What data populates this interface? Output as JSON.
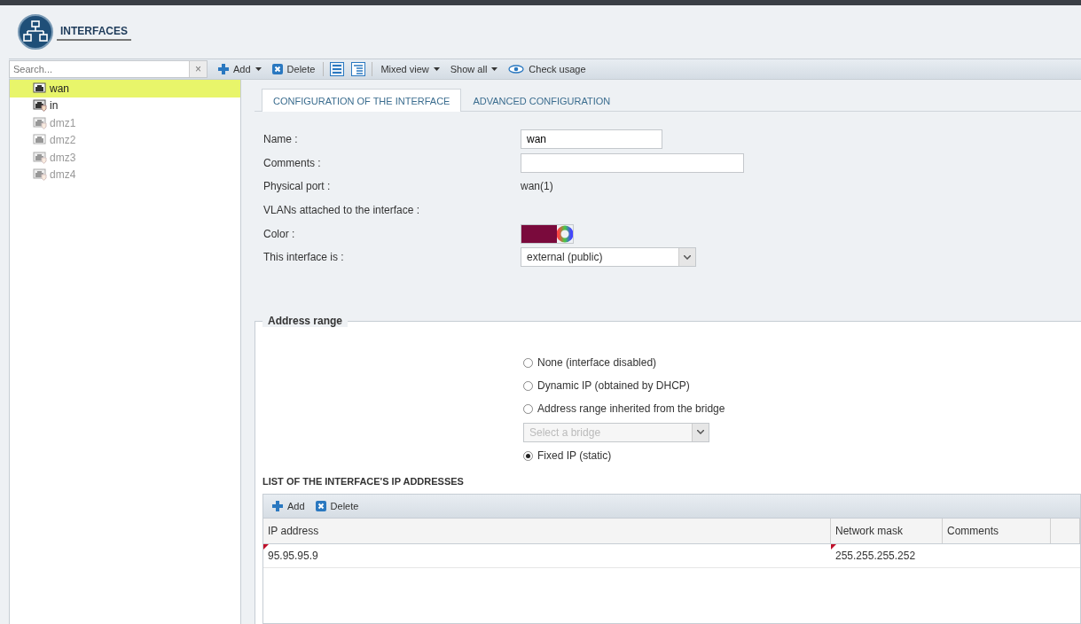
{
  "header": {
    "title": "INTERFACES"
  },
  "toolbar": {
    "search": {
      "placeholder": "Search..."
    },
    "clear": "×",
    "items": [
      {
        "kind": "add",
        "label": "Add",
        "dropdown": true
      },
      {
        "kind": "delete",
        "label": "Delete",
        "dropdown": false
      },
      {
        "kind": "separator"
      },
      {
        "kind": "expand"
      },
      {
        "kind": "collapse"
      },
      {
        "kind": "separator"
      },
      {
        "kind": "text",
        "label": "Mixed view",
        "dropdown": true
      },
      {
        "kind": "text",
        "label": "Show all",
        "dropdown": true
      },
      {
        "kind": "eye",
        "label": "Check usage",
        "dropdown": false
      }
    ]
  },
  "sidebar": {
    "items": [
      {
        "label": "wan",
        "selected": true,
        "disabled": false,
        "kind": "external"
      },
      {
        "label": "in",
        "selected": false,
        "disabled": false,
        "kind": "protected"
      },
      {
        "label": "dmz1",
        "selected": false,
        "disabled": true,
        "kind": "protected"
      },
      {
        "label": "dmz2",
        "selected": false,
        "disabled": true,
        "kind": "external"
      },
      {
        "label": "dmz3",
        "selected": false,
        "disabled": true,
        "kind": "protected"
      },
      {
        "label": "dmz4",
        "selected": false,
        "disabled": true,
        "kind": "protected"
      }
    ]
  },
  "tabs": [
    {
      "label": "CONFIGURATION OF THE INTERFACE",
      "selected": true
    },
    {
      "label": "ADVANCED CONFIGURATION",
      "selected": false
    }
  ],
  "form": [
    {
      "kind": "input",
      "label": "Name :",
      "value": "wan",
      "wide": false
    },
    {
      "kind": "input",
      "label": "Comments :",
      "wide": true
    },
    {
      "kind": "text",
      "label": "Physical port :",
      "value": "wan(1)"
    },
    {
      "kind": "label",
      "label": "VLANs attached to the interface :"
    },
    {
      "kind": "color",
      "label": "Color :",
      "color": "#7a0a3c"
    },
    {
      "kind": "select",
      "label": "This interface is :",
      "value": "external (public)"
    }
  ],
  "address_range": {
    "legend": "Address range",
    "options": [
      {
        "kind": "radio",
        "label": "None (interface disabled)",
        "selected": false
      },
      {
        "kind": "radio",
        "label": "Dynamic IP (obtained by DHCP)",
        "selected": false
      },
      {
        "kind": "radio",
        "label": "Address range inherited from the bridge",
        "selected": false
      },
      {
        "kind": "select",
        "placeholder": "Select a bridge",
        "disabled": true
      },
      {
        "kind": "radio",
        "label": "Fixed IP (static)",
        "selected": true
      }
    ]
  },
  "ip_list": {
    "title": "LIST OF THE INTERFACE'S IP ADDRESSES",
    "buttons": [
      {
        "kind": "add",
        "label": "Add"
      },
      {
        "kind": "delete",
        "label": "Delete"
      }
    ],
    "columns": [
      "IP address",
      "Network mask",
      "Comments"
    ],
    "rows": [
      {
        "cells": [
          "95.95.95.9",
          "255.255.255.252",
          null
        ],
        "modified": [
          true,
          true,
          false
        ]
      }
    ]
  }
}
